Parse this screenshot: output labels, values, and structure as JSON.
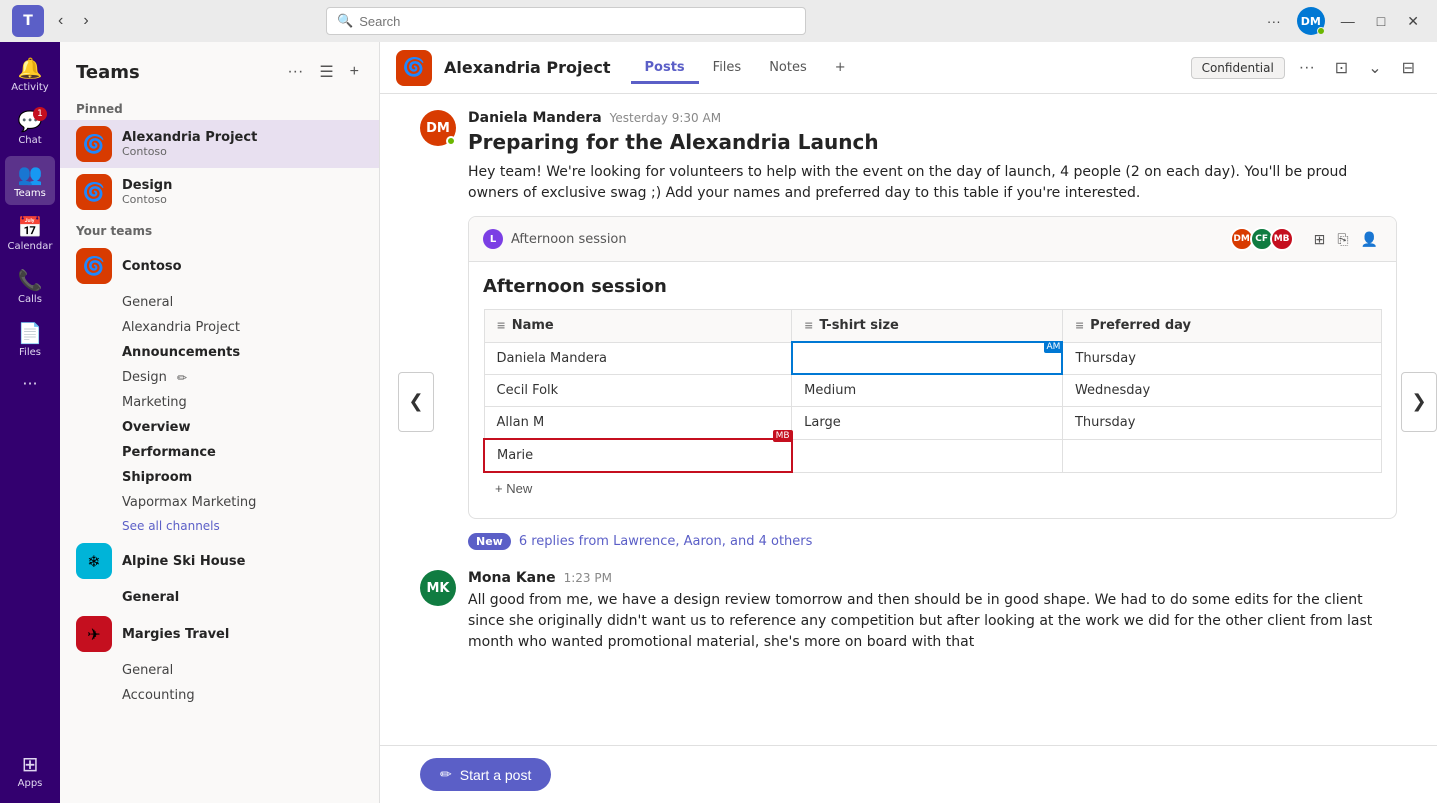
{
  "titleBar": {
    "searchPlaceholder": "Search",
    "moreLabel": "...",
    "minimize": "—",
    "maximize": "□",
    "close": "✕"
  },
  "sideIcons": [
    {
      "id": "activity",
      "label": "Activity",
      "icon": "🔔",
      "badge": null
    },
    {
      "id": "chat",
      "label": "Chat",
      "icon": "💬",
      "badge": "1"
    },
    {
      "id": "teams",
      "label": "Teams",
      "icon": "👥",
      "badge": null,
      "active": true
    },
    {
      "id": "calendar",
      "label": "Calendar",
      "icon": "📅",
      "badge": null
    },
    {
      "id": "calls",
      "label": "Calls",
      "icon": "📞",
      "badge": null
    },
    {
      "id": "files",
      "label": "Files",
      "icon": "📄",
      "badge": null
    },
    {
      "id": "more",
      "label": "...",
      "icon": "···",
      "badge": null
    },
    {
      "id": "apps",
      "label": "Apps",
      "icon": "⊞",
      "badge": null
    }
  ],
  "teamsPanel": {
    "title": "Teams",
    "pinned": {
      "label": "Pinned",
      "items": [
        {
          "id": "alexandria",
          "name": "Alexandria Project",
          "sub": "Contoso",
          "iconColor": "#d83b01",
          "iconEmoji": "🌀",
          "active": true
        },
        {
          "id": "design",
          "name": "Design",
          "sub": "Contoso",
          "iconColor": "#d83b01",
          "iconEmoji": "🌀"
        }
      ]
    },
    "yourTeams": {
      "label": "Your teams",
      "teams": [
        {
          "id": "contoso",
          "name": "Contoso",
          "iconColor": "#d83b01",
          "iconEmoji": "🌀",
          "channels": [
            {
              "name": "General",
              "bold": false
            },
            {
              "name": "Alexandria Project",
              "bold": false
            },
            {
              "name": "Announcements",
              "bold": true
            },
            {
              "name": "Design",
              "bold": false,
              "hasEdit": true
            },
            {
              "name": "Marketing",
              "bold": false
            },
            {
              "name": "Overview",
              "bold": true
            },
            {
              "name": "Performance",
              "bold": true
            },
            {
              "name": "Shiproom",
              "bold": true
            },
            {
              "name": "Vapormax Marketing",
              "bold": false
            },
            {
              "name": "See all channels",
              "isSeeAll": true
            }
          ]
        },
        {
          "id": "alpine",
          "name": "Alpine Ski House",
          "iconColor": "#00b4d8",
          "iconEmoji": "❄",
          "channels": [
            {
              "name": "General",
              "bold": true
            }
          ]
        },
        {
          "id": "margies",
          "name": "Margies Travel",
          "iconColor": "#c50f1f",
          "iconEmoji": "✈",
          "channels": [
            {
              "name": "General",
              "bold": false
            },
            {
              "name": "Accounting",
              "bold": false
            }
          ]
        }
      ]
    }
  },
  "channelHeader": {
    "teamIcon": "🌀",
    "teamName": "Alexandria Project",
    "tabs": [
      {
        "label": "Posts",
        "active": true
      },
      {
        "label": "Files",
        "active": false
      },
      {
        "label": "Notes",
        "active": false
      }
    ],
    "addTab": "+",
    "confidential": "Confidential"
  },
  "messages": [
    {
      "id": "msg1",
      "authorInitials": "DM",
      "authorColor": "#d83b01",
      "authorName": "Daniela Mandera",
      "time": "Yesterday 9:30 AM",
      "hasStatus": true,
      "title": "Preparing for the Alexandria Launch",
      "text": "Hey team! We're looking for volunteers to help with the event on the day of launch, 4 people (2 on each day). You'll be proud owners of exclusive swag ;) Add your names and preferred day to this table if you're interested."
    }
  ],
  "loopCard": {
    "iconLabel": "L",
    "titleSmall": "Afternoon session",
    "avatars": [
      {
        "initials": "DM",
        "color": "#d83b01"
      },
      {
        "initials": "CF",
        "color": "#107c41"
      },
      {
        "initials": "MB",
        "color": "#c50f1f"
      }
    ],
    "title": "Afternoon session",
    "columns": [
      {
        "label": "Name"
      },
      {
        "label": "T-shirt size"
      },
      {
        "label": "Preferred day"
      }
    ],
    "rows": [
      {
        "name": "Daniela Mandera",
        "tshirt": "",
        "day": "Thursday",
        "tdEditingTshirt": true,
        "cursorAM": true
      },
      {
        "name": "Cecil Folk",
        "tshirt": "Medium",
        "day": "Wednesday"
      },
      {
        "name": "Allan M",
        "tshirt": "Large",
        "day": "Thursday"
      },
      {
        "name": "Marie",
        "tshirt": "",
        "day": "",
        "tdRedBorder": true,
        "cursorMB": true
      }
    ],
    "newRowLabel": "+ New"
  },
  "replyBadge": {
    "newLabel": "New",
    "text": "6 replies from Lawrence, Aaron, and 4 others"
  },
  "secondMessage": {
    "authorInitials": "MK",
    "authorColor": "#107c41",
    "authorName": "Mona Kane",
    "time": "1:23 PM",
    "text": "All good from me, we have a design review tomorrow and then should be in good shape. We had to do some edits for the client since she originally didn't want us to reference any competition but after looking at the work we did for the other client from last month who wanted promotional material, she's more on board with that"
  },
  "postBar": {
    "buttonLabel": "Start a post",
    "buttonIcon": "✏"
  }
}
